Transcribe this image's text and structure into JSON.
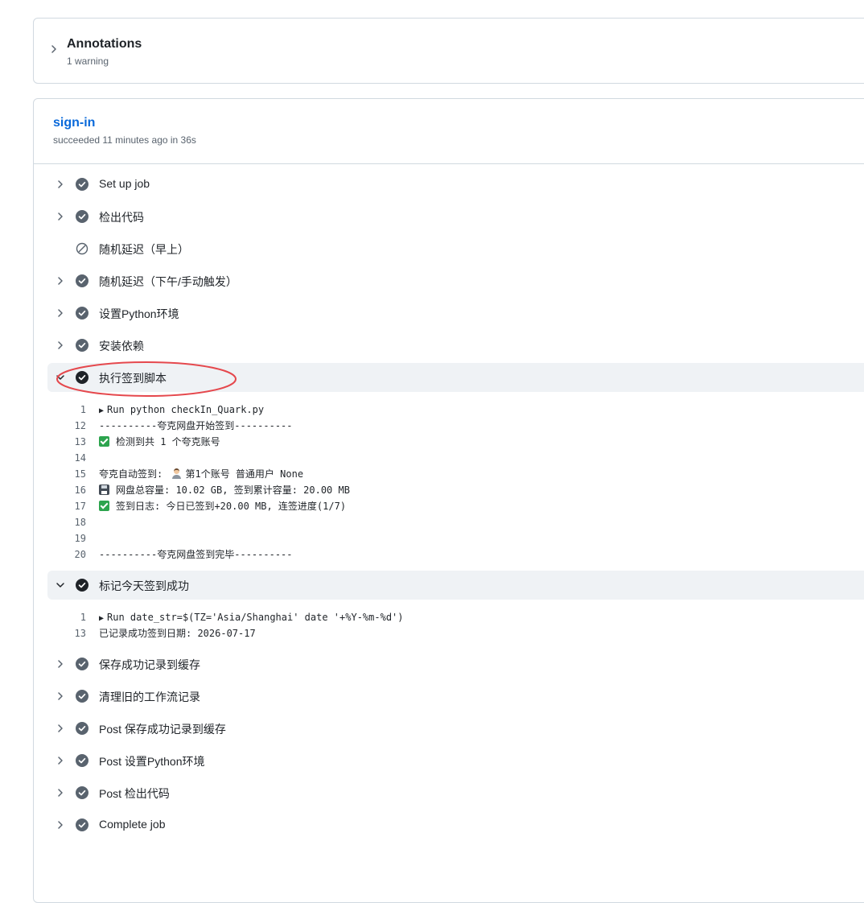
{
  "annotations": {
    "title": "Annotations",
    "subtitle": "1 warning"
  },
  "job": {
    "name": "sign-in",
    "status_text": "succeeded 11 minutes ago in 36s"
  },
  "steps": [
    {
      "label": "Set up job",
      "status": "success",
      "expanded": false
    },
    {
      "label": "检出代码",
      "status": "success",
      "expanded": false
    },
    {
      "label": "随机延迟（早上）",
      "status": "skipped",
      "expanded": false
    },
    {
      "label": "随机延迟（下午/手动触发）",
      "status": "success",
      "expanded": false
    },
    {
      "label": "设置Python环境",
      "status": "success",
      "expanded": false
    },
    {
      "label": "安装依赖",
      "status": "success",
      "expanded": false
    },
    {
      "label": "执行签到脚本",
      "status": "success",
      "expanded": true
    },
    {
      "label": "标记今天签到成功",
      "status": "success",
      "expanded": true
    },
    {
      "label": "保存成功记录到缓存",
      "status": "success",
      "expanded": false
    },
    {
      "label": "清理旧的工作流记录",
      "status": "success",
      "expanded": false
    },
    {
      "label": "Post 保存成功记录到缓存",
      "status": "success",
      "expanded": false
    },
    {
      "label": "Post 设置Python环境",
      "status": "success",
      "expanded": false
    },
    {
      "label": "Post 检出代码",
      "status": "success",
      "expanded": false
    },
    {
      "label": "Complete job",
      "status": "success",
      "expanded": false
    }
  ],
  "logs": {
    "checkin": [
      {
        "n": "1",
        "text": "Run python checkIn_Quark.py",
        "prefix": "triangle-icon"
      },
      {
        "n": "12",
        "text": "----------夸克网盘开始签到----------"
      },
      {
        "n": "13",
        "text": "检测到共 1 个夸克账号",
        "prefix": "check-emoji-icon"
      },
      {
        "n": "14",
        "text": ""
      },
      {
        "n": "15",
        "text": "夸克自动签到:",
        "suffix_icon": "person-emoji-icon",
        "text2": "第1个账号 普通用户 None"
      },
      {
        "n": "16",
        "text": "网盘总容量: 10.02 GB, 签到累计容量: 20.00 MB",
        "prefix": "floppy-disk-icon"
      },
      {
        "n": "17",
        "text": "签到日志: 今日已签到+20.00 MB, 连签进度(1/7)",
        "prefix": "check-emoji-icon"
      },
      {
        "n": "18",
        "text": ""
      },
      {
        "n": "19",
        "text": ""
      },
      {
        "n": "20",
        "text": "----------夸克网盘签到完毕----------"
      }
    ],
    "mark": [
      {
        "n": "1",
        "text": "Run date_str=$(TZ='Asia/Shanghai' date '+%Y-%m-%d')",
        "prefix": "triangle-icon"
      },
      {
        "n": "13",
        "text": "已记录成功签到日期: 2026-07-17"
      }
    ]
  },
  "colors": {
    "link": "#0969da",
    "success_icon": "#59636e",
    "expanded_icon": "#1f2328",
    "annotation_circle": "#e5484d"
  }
}
